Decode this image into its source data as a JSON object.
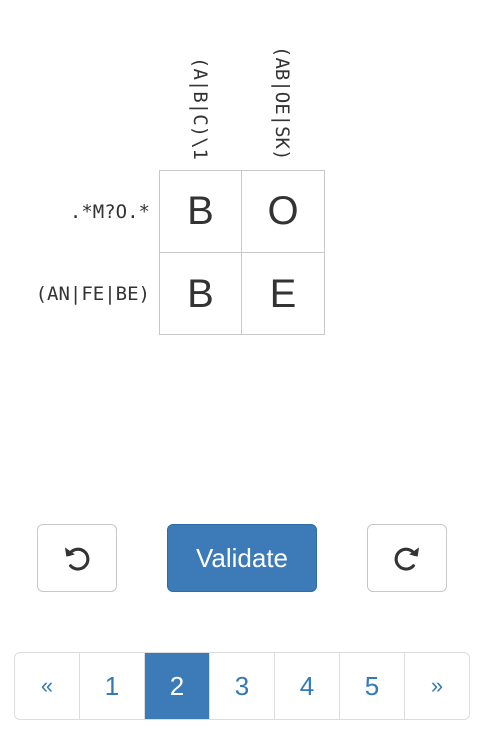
{
  "puzzle": {
    "column_clues": [
      "(A|B|C)\\1",
      "(AB|OE|SK)"
    ],
    "row_clues": [
      ".*M?O.*",
      "(AN|FE|BE)"
    ],
    "cells": [
      [
        "B",
        "O"
      ],
      [
        "B",
        "E"
      ]
    ]
  },
  "actions": {
    "undo_icon": "undo-arrow-icon",
    "validate_label": "Validate",
    "redo_icon": "redo-arrow-icon"
  },
  "pagination": {
    "prev": "«",
    "pages": [
      "1",
      "2",
      "3",
      "4",
      "5"
    ],
    "active_page": "2",
    "next": "»"
  },
  "colors": {
    "primary": "#3c7ab8",
    "link": "#337ab7",
    "border": "#c8c8c8"
  }
}
